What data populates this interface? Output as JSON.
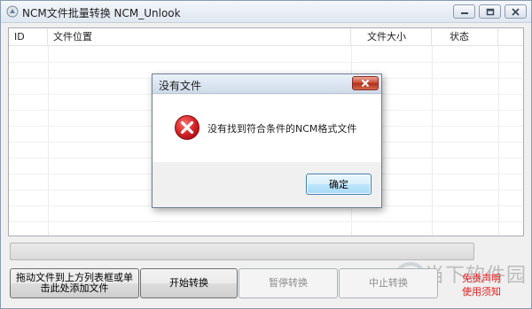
{
  "window": {
    "title": "NCM文件批量转换 NCM_Unlook"
  },
  "list": {
    "columns": [
      {
        "label": "ID"
      },
      {
        "label": "文件位置"
      },
      {
        "label": "文件大小"
      },
      {
        "label": "状态"
      }
    ]
  },
  "progress": {
    "value": 0
  },
  "buttons": {
    "add_files": "拖动文件到上方列表框或单击此处添加文件",
    "start": "开始转换",
    "pause": "暂停转换",
    "stop": "中止转换"
  },
  "links": {
    "disclaimer": "免责声明",
    "usage_notes": "使用须知"
  },
  "watermark": {
    "text": "当下软件园"
  },
  "dialog": {
    "title": "没有文件",
    "message": "没有找到符合条件的NCM格式文件",
    "ok_label": "确定"
  },
  "colors": {
    "link_red": "#e31b1b",
    "error_red": "#d8232a",
    "dialog_close_red": "#c7452f"
  },
  "icons": {
    "app": "app-icon",
    "minimize": "minimize-icon",
    "restore": "restore-icon",
    "close": "close-icon",
    "error": "error-icon"
  }
}
